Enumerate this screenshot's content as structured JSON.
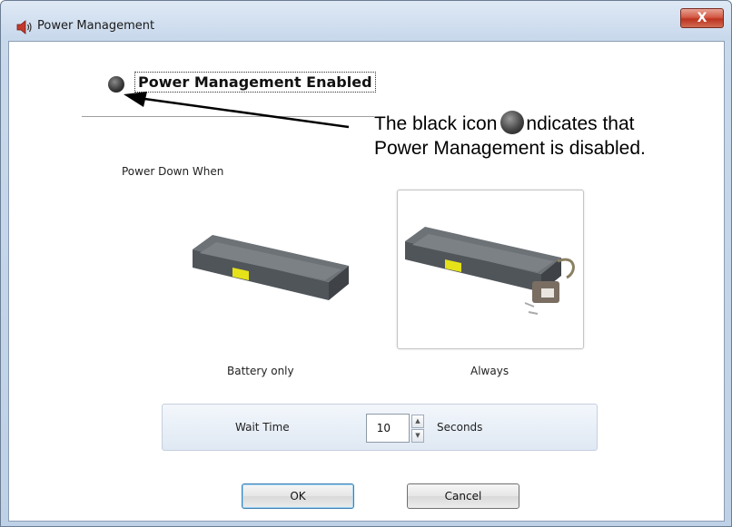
{
  "window": {
    "title": "Power Management",
    "close_label": "X"
  },
  "power_management": {
    "enabled_label": "Power Management Enabled",
    "indicator_state": "disabled",
    "indicator_color": "#2a2a2a"
  },
  "annotation": {
    "text_before_icon": "The black icon",
    "text_after_icon": "ndicates that",
    "line_2": "Power Management is disabled."
  },
  "power_down": {
    "section_label": "Power Down When",
    "options": [
      {
        "label": "Battery only",
        "selected": false,
        "icon": "battery-icon"
      },
      {
        "label": "Always",
        "selected": true,
        "icon": "battery-with-plug-icon"
      }
    ]
  },
  "wait": {
    "label": "Wait Time",
    "value": "10",
    "unit": "Seconds"
  },
  "buttons": {
    "ok": "OK",
    "cancel": "Cancel"
  }
}
